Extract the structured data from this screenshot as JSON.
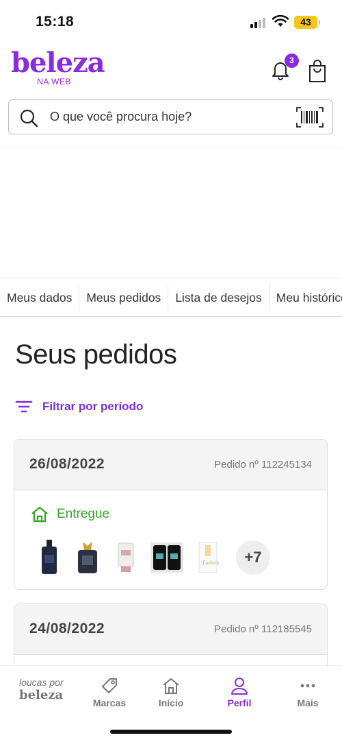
{
  "status_bar": {
    "time": "15:18",
    "battery": "43"
  },
  "header": {
    "logo_main": "beleza",
    "logo_sub": "NA WEB",
    "notification_count": "3"
  },
  "search": {
    "placeholder": "O que você procura hoje?"
  },
  "tabs": [
    {
      "label": "Meus dados"
    },
    {
      "label": "Meus pedidos"
    },
    {
      "label": "Lista de desejos"
    },
    {
      "label": "Meu histórico"
    }
  ],
  "page_title": "Seus pedidos",
  "filter_label": "Filtrar por período",
  "orders": [
    {
      "date": "26/08/2022",
      "number": "Pedido nº 112245134",
      "status": "Entregue",
      "more_count": "+7"
    },
    {
      "date": "24/08/2022",
      "number": "Pedido nº 112185545"
    }
  ],
  "bottom_nav": {
    "brand_top": "loucas por",
    "brand_bottom": "beleza",
    "items": [
      {
        "label": "Marcas"
      },
      {
        "label": "Início"
      },
      {
        "label": "Perfil"
      },
      {
        "label": "Mais"
      }
    ]
  },
  "colors": {
    "accent": "#8a2be2",
    "success": "#3aa52a"
  }
}
